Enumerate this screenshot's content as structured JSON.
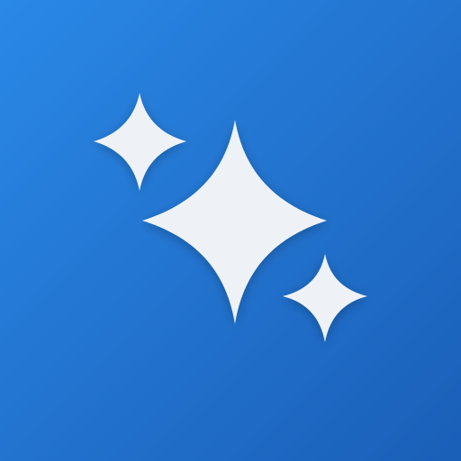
{
  "icon": {
    "name": "sparkles-app-icon",
    "glyph": "sparkles-icon",
    "sparkle_count": 3,
    "colors": {
      "background_top_left": "#2a88e6",
      "background_bottom_right": "#1a5fb8",
      "sparkle_fill": "#eef2f7",
      "sparkle_glow": "#ffffff"
    }
  }
}
